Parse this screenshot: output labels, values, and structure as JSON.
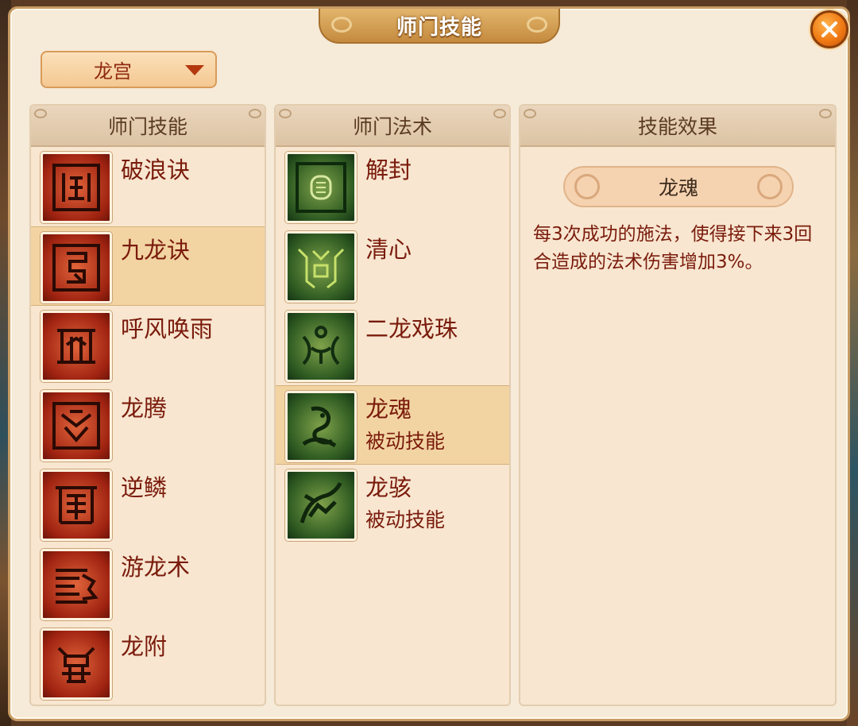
{
  "window": {
    "title": "师门技能"
  },
  "school_select": {
    "selected": "龙宫"
  },
  "columns": {
    "skills": {
      "header": "师门技能",
      "items": [
        {
          "name": "破浪诀",
          "icon": "wave-rune-icon"
        },
        {
          "name": "九龙诀",
          "icon": "nine-dragon-rune-icon",
          "selected": true
        },
        {
          "name": "呼风唤雨",
          "icon": "wind-rain-rune-icon"
        },
        {
          "name": "龙腾",
          "icon": "dragon-soar-rune-icon"
        },
        {
          "name": "逆鳞",
          "icon": "reverse-scale-rune-icon"
        },
        {
          "name": "游龙术",
          "icon": "swimming-dragon-rune-icon"
        },
        {
          "name": "龙附",
          "icon": "dragon-attach-rune-icon"
        }
      ]
    },
    "spells": {
      "header": "师门法术",
      "items": [
        {
          "name": "解封",
          "sub": "",
          "icon": "unseal-icon"
        },
        {
          "name": "清心",
          "sub": "",
          "icon": "clear-mind-icon"
        },
        {
          "name": "二龙戏珠",
          "sub": "",
          "icon": "twin-dragon-pearl-icon"
        },
        {
          "name": "龙魂",
          "sub": "被动技能",
          "icon": "dragon-soul-icon",
          "selected": true
        },
        {
          "name": "龙骇",
          "sub": "被动技能",
          "icon": "dragon-fright-icon"
        }
      ]
    },
    "effect": {
      "header": "技能效果",
      "skill_name": "龙魂",
      "description": "每3次成功的施法，使得接下来3回合造成的法术伤害增加3%。"
    }
  },
  "colors": {
    "accent": "#c48a3e",
    "text": "#7a1b0c",
    "selected_row": "#f2d4a2"
  }
}
